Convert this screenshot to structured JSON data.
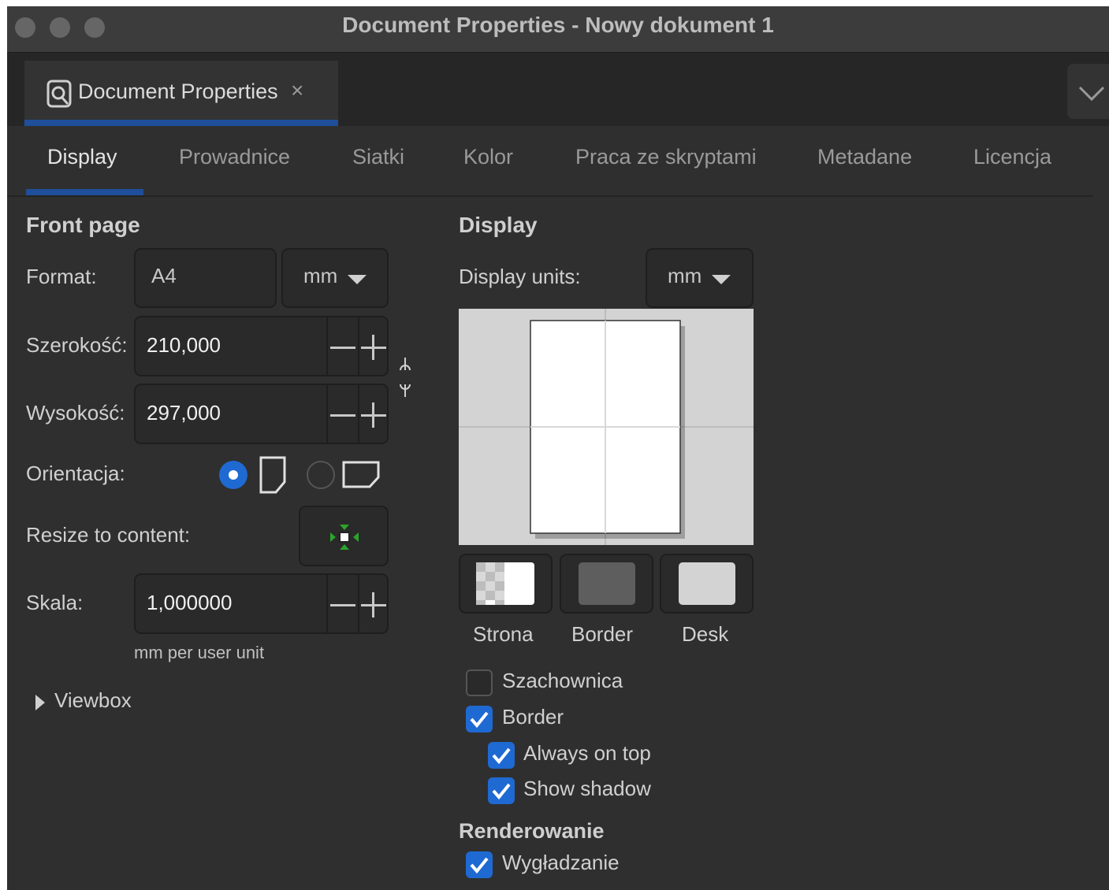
{
  "window": {
    "title": "Document Properties - Nowy dokument 1"
  },
  "dock": {
    "tab_label": "Document Properties",
    "close_glyph": "×",
    "tab_icon": "document-properties-icon",
    "collapse_icon": "chevron-down-icon"
  },
  "tabs": [
    {
      "label": "Display",
      "active": true
    },
    {
      "label": "Prowadnice"
    },
    {
      "label": "Siatki"
    },
    {
      "label": "Kolor"
    },
    {
      "label": "Praca ze skryptami"
    },
    {
      "label": "Metadane"
    },
    {
      "label": "Licencja"
    }
  ],
  "front_page": {
    "header": "Front page",
    "format_label": "Format:",
    "format_value": "A4",
    "format_unit": "mm",
    "width_label": "Szerokość:",
    "width_value": "210,000",
    "height_label": "Wysokość:",
    "height_value": "297,000",
    "orientation_label": "Orientacja:",
    "orientation_selected": "portrait",
    "resize_label": "Resize to content:",
    "scale_label": "Skala:",
    "scale_value": "1,000000",
    "scale_unit_note": "mm per user unit",
    "viewbox_label": "Viewbox",
    "minus_glyph": "—",
    "plus_glyph": "+"
  },
  "display": {
    "header": "Display",
    "units_label": "Display units:",
    "units_value": "mm",
    "swatches": [
      {
        "label": "Strona",
        "color": "#ffffff"
      },
      {
        "label": "Border",
        "color": "#5e5e5e"
      },
      {
        "label": "Desk",
        "color": "#d3d3d3"
      }
    ],
    "checkboxes": [
      {
        "label": "Szachownica",
        "checked": false
      },
      {
        "label": "Border",
        "checked": true
      },
      {
        "label": "Always on top",
        "checked": true
      },
      {
        "label": "Show shadow",
        "checked": true
      }
    ],
    "rendering_header": "Renderowanie",
    "antialias_label": "Wygładzanie",
    "antialias_checked": true
  },
  "colors": {
    "accent": "#1f69d2",
    "tab_underline": "#1f4f9a",
    "panel_bg": "#2f2f2f"
  }
}
